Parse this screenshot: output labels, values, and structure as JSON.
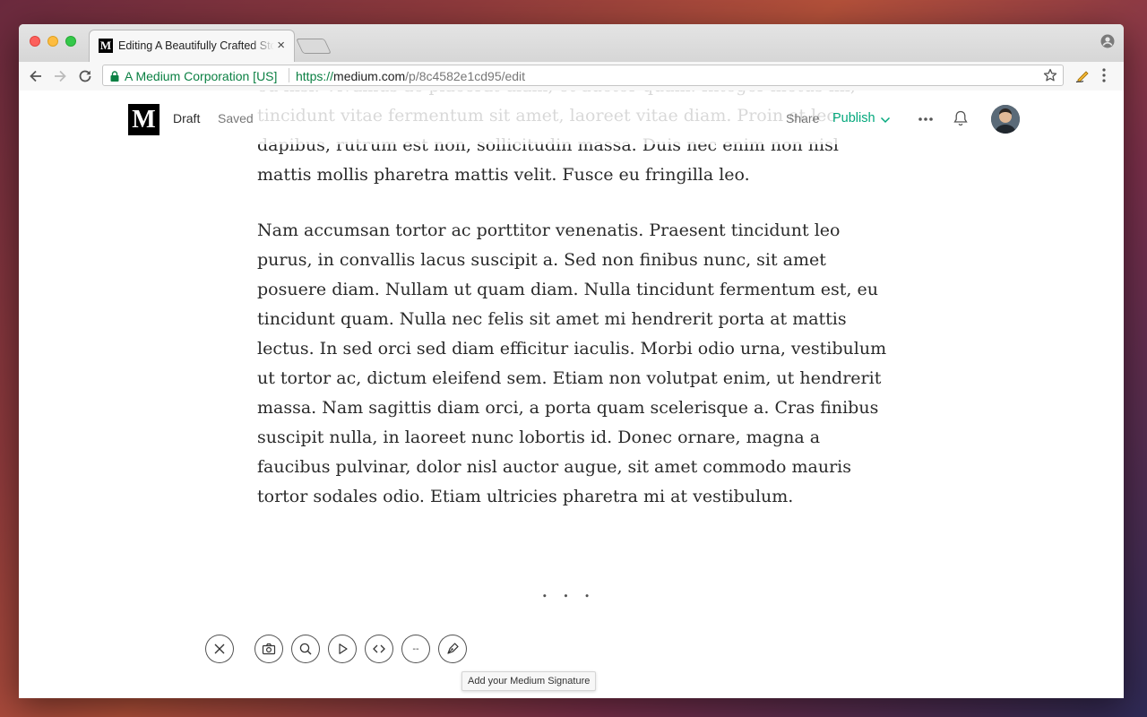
{
  "browser": {
    "tab_title": "Editing A Beautifully Crafted Story",
    "tab_close": "×",
    "security_label": "A Medium Corporation [US]",
    "url_protocol": "https://",
    "url_host": "medium.com",
    "url_path": "/p/8c4582e1cd95/edit"
  },
  "header": {
    "logo": "M",
    "status_draft": "Draft",
    "status_saved": "Saved",
    "share_label": "Share",
    "publish_label": "Publish"
  },
  "article": {
    "paragraph_1": "eu nisl. Vivamus ac placerat diam, et auctor quam. Integer metus mi, tincidunt vitae fermentum sit amet, laoreet vitae diam. Proin et leo dapibus, rutrum est non, sollicitudin massa. Duis nec enim non nisl mattis mollis pharetra mattis velit. Fusce eu fringilla leo.",
    "paragraph_2": "Nam accumsan tortor ac porttitor venenatis. Praesent tincidunt leo purus, in convallis lacus suscipit a. Sed non finibus nunc, sit amet posuere diam. Nullam ut quam diam. Nulla tincidunt fermentum est, eu tincidunt quam. Nulla nec felis sit amet mi hendrerit porta at mattis lectus. In sed orci sed diam efficitur iaculis. Morbi odio urna, vestibulum ut tortor ac, dictum eleifend sem. Etiam non volutpat enim, ut hendrerit massa. Nam sagittis diam orci, a porta quam scelerisque a. Cras finibus suscipit nulla, in laoreet nunc lobortis id. Donec ornare, magna a faucibus pulvinar, dolor nisl auctor augue, sit amet commodo mauris tortor sodales odio. Etiam ultricies pharetra mi at vestibulum.",
    "section_separator": "..."
  },
  "insert_toolbar": {
    "buttons": [
      "close-icon",
      "camera-icon",
      "search-icon",
      "play-icon",
      "code-icon",
      "dash-icon",
      "pen-icon"
    ],
    "divider_glyph": "--",
    "tooltip": "Add your Medium Signature"
  },
  "colors": {
    "accent": "#03a87c",
    "secure": "#0b8043"
  }
}
